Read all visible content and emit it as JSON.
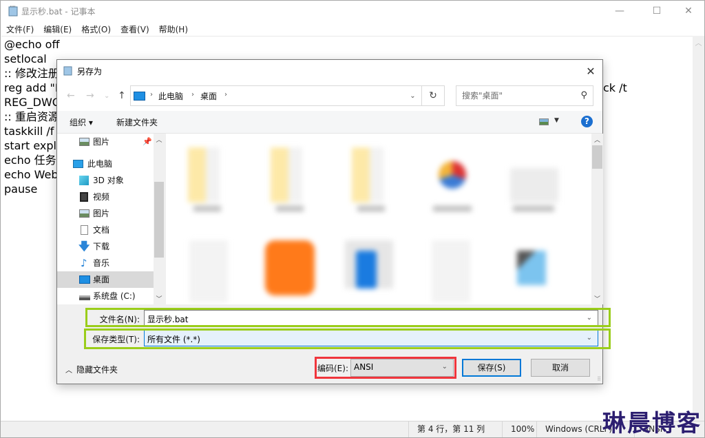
{
  "notepad": {
    "title": "显示秒.bat - 记事本",
    "menu": [
      "文件(F)",
      "编辑(E)",
      "格式(O)",
      "查看(V)",
      "帮助(H)"
    ],
    "lines_visible_left": [
      "@echo off",
      "setlocal",
      ":: 修改注册",
      "reg add \"H",
      "REG_DWO",
      ":: 重启资源",
      "taskkill /f /",
      "start explo",
      "echo 任务",
      "echo Web",
      "pause"
    ],
    "line4_right_fragment": "ck /t",
    "status": {
      "position": "第 4 行，第 11 列",
      "zoom": "100%",
      "line_ending": "Windows (CRLF)",
      "encoding": "ANSI"
    },
    "window_controls": {
      "minimize": "—",
      "maximize": "☐",
      "close": "✕"
    }
  },
  "watermark": "琳晨博客",
  "dialog": {
    "title": "另存为",
    "close": "✕",
    "nav": {
      "back": "←",
      "forward": "→",
      "recent": "⌄",
      "up": "↑"
    },
    "breadcrumb": [
      "此电脑",
      "桌面"
    ],
    "search_placeholder": "搜索\"桌面\"",
    "toolbar": {
      "organize": "组织 ▾",
      "new_folder": "新建文件夹",
      "help": "?"
    },
    "nav_pane": [
      {
        "label": "图片",
        "icon": "pictures-icon",
        "pinned": true
      },
      {
        "label": "此电脑",
        "icon": "this-pc-icon"
      },
      {
        "label": "3D 对象",
        "icon": "3d-objects-icon"
      },
      {
        "label": "视频",
        "icon": "videos-icon"
      },
      {
        "label": "图片",
        "icon": "pictures-icon"
      },
      {
        "label": "文档",
        "icon": "documents-icon"
      },
      {
        "label": "下载",
        "icon": "downloads-icon"
      },
      {
        "label": "音乐",
        "icon": "music-icon"
      },
      {
        "label": "桌面",
        "icon": "desktop-icon",
        "selected": true
      },
      {
        "label": "系统盘 (C:)",
        "icon": "drive-icon"
      }
    ],
    "file_name_label": "文件名(N):",
    "file_name": "显示秒.bat",
    "save_type_label": "保存类型(T):",
    "save_type": "所有文件  (*.*)",
    "hide_folders": "隐藏文件夹",
    "encoding_label": "编码(E):",
    "encoding": "ANSI",
    "save_button": "保存(S)",
    "cancel_button": "取消"
  },
  "colors": {
    "highlight_green": "#9acd1a",
    "highlight_red": "#f0353c",
    "accent": "#0078d7"
  }
}
